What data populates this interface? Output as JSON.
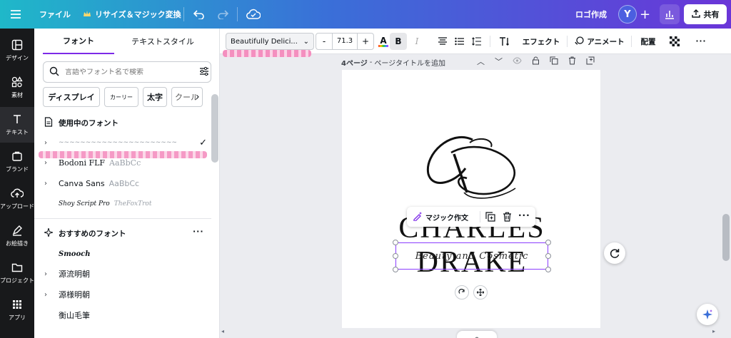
{
  "topbar": {
    "menu_icon": "hamburger-icon",
    "file_label": "ファイル",
    "resize_label": "リサイズ＆マジック変換",
    "logo_label": "ロゴ作成",
    "avatar_initial": "Y",
    "share_label": "共有"
  },
  "rail": {
    "items": [
      {
        "label": "デザイン",
        "icon": "layout-icon"
      },
      {
        "label": "素材",
        "icon": "shapes-icon"
      },
      {
        "label": "テキスト",
        "icon": "text-icon"
      },
      {
        "label": "ブランド",
        "icon": "brand-icon"
      },
      {
        "label": "アップロード",
        "icon": "upload-icon"
      },
      {
        "label": "お絵描き",
        "icon": "draw-icon"
      },
      {
        "label": "プロジェクト",
        "icon": "folder-icon"
      },
      {
        "label": "アプリ",
        "icon": "apps-icon"
      }
    ]
  },
  "panel": {
    "tabs": [
      "フォント",
      "テキストスタイル"
    ],
    "search_placeholder": "言語やフォント名で検索",
    "chips": [
      "ディスプレイ",
      "カーリー",
      "太字",
      "クール"
    ],
    "in_use_title": "使用中のフォント",
    "in_use_fonts": [
      {
        "name": "Bodoni FLF",
        "sample": "AaBbCc"
      },
      {
        "name": "Canva Sans",
        "sample": "AaBbCc"
      }
    ],
    "script_sample_1": "Shoy Script Pro",
    "script_sample_2": "TheFoxTrot",
    "recommended_title": "おすすめのフォント",
    "recommended_fonts": [
      "Smooch",
      "源流明朝",
      "源様明朝",
      "衡山毛筆"
    ]
  },
  "toolbar": {
    "font_name": "Beautifully Delici...",
    "font_size": "71.3",
    "minus": "-",
    "plus": "+",
    "effects_label": "エフェクト",
    "animate_label": "アニメート",
    "position_label": "配置"
  },
  "page": {
    "page_label": "4ページ",
    "page_title_placeholder": "ページタイトルを追加",
    "brand_name": "CHARLES DRAKE",
    "tagline": "Beauty and Cosmetic",
    "context_menu_label": "マジック作文"
  },
  "colors": {
    "accent": "#7d2ae8",
    "selection": "#8b3dff",
    "rail_bg": "#18191b"
  }
}
